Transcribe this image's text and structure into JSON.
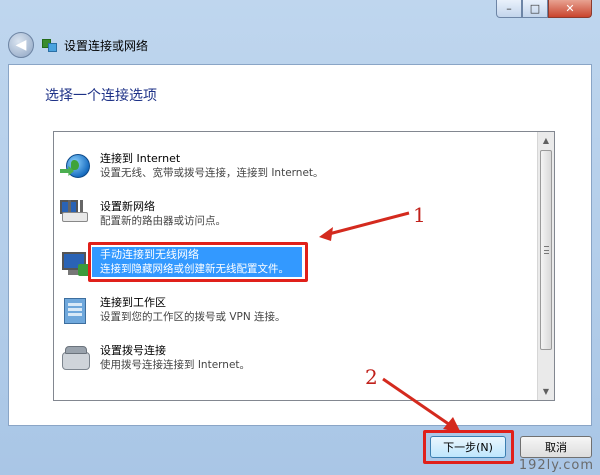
{
  "window": {
    "caption_minimize": "–",
    "caption_maximize": "□",
    "caption_close": "✕"
  },
  "nav": {
    "back_glyph": "◀",
    "title": "设置连接或网络"
  },
  "heading": "选择一个连接选项",
  "options": [
    {
      "title": "连接到 Internet",
      "desc": "设置无线、宽带或拨号连接，连接到 Internet。",
      "icon": "globe-icon"
    },
    {
      "title": "设置新网络",
      "desc": "配置新的路由器或访问点。",
      "icon": "router-icon"
    },
    {
      "title": "手动连接到无线网络",
      "desc": "连接到隐藏网络或创建新无线配置文件。",
      "icon": "wireless-monitor-icon",
      "selected": true
    },
    {
      "title": "连接到工作区",
      "desc": "设置到您的工作区的拨号或 VPN 连接。",
      "icon": "workplace-icon"
    },
    {
      "title": "设置拨号连接",
      "desc": "使用拨号连接连接到 Internet。",
      "icon": "phone-icon"
    }
  ],
  "annotations": {
    "one": "1",
    "two": "2"
  },
  "buttons": {
    "next": "下一步(N)",
    "cancel": "取消"
  },
  "watermark": "192ly.com",
  "colors": {
    "selection": "#3399ff",
    "annotation_red": "#e0201a",
    "heading_blue": "#1e3287"
  }
}
